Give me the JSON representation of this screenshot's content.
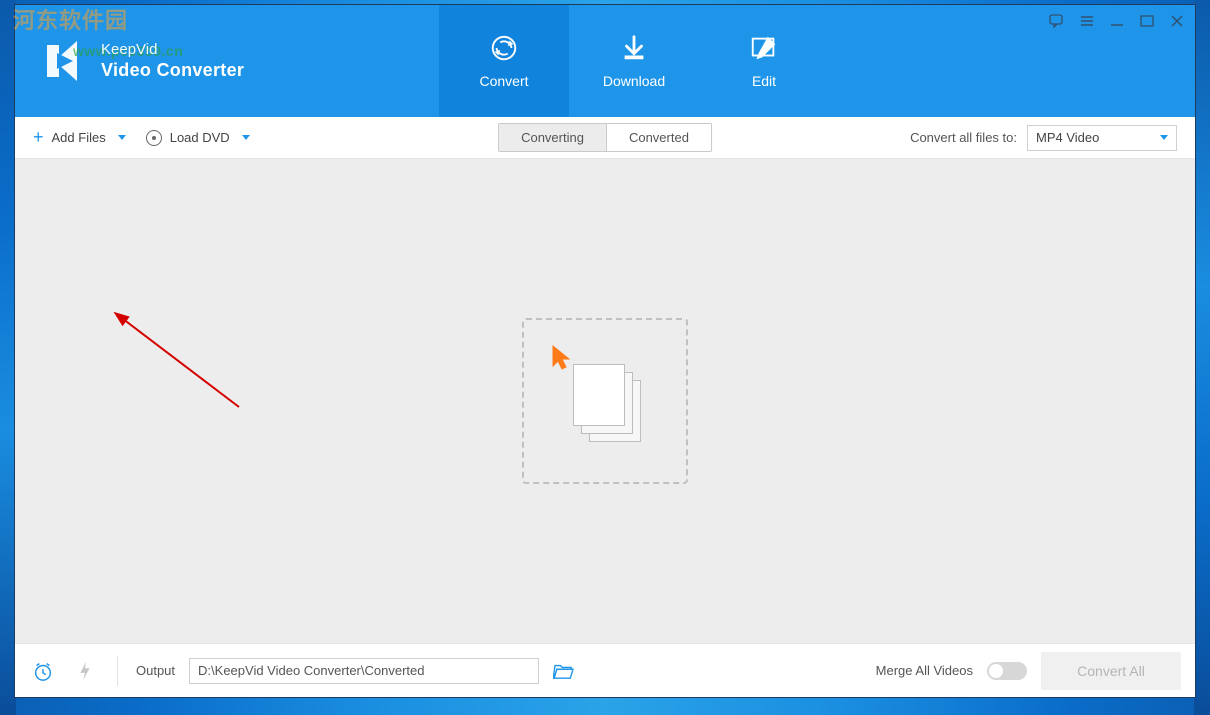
{
  "branding": {
    "line1": "KeepVid",
    "line2": "Video Converter"
  },
  "watermark": {
    "text1": "河东软件园",
    "text2": "www.pc0359.cn"
  },
  "tabs": {
    "convert": "Convert",
    "download": "Download",
    "edit": "Edit"
  },
  "toolbar": {
    "add_files": "Add Files",
    "load_dvd": "Load DVD",
    "segment": {
      "converting": "Converting",
      "converted": "Converted"
    },
    "convert_all_lbl": "Convert all files to:",
    "format_value": "MP4 Video"
  },
  "footer": {
    "output_lbl": "Output",
    "output_path": "D:\\KeepVid Video Converter\\Converted",
    "merge_lbl": "Merge All Videos",
    "convert_all_btn": "Convert All"
  }
}
